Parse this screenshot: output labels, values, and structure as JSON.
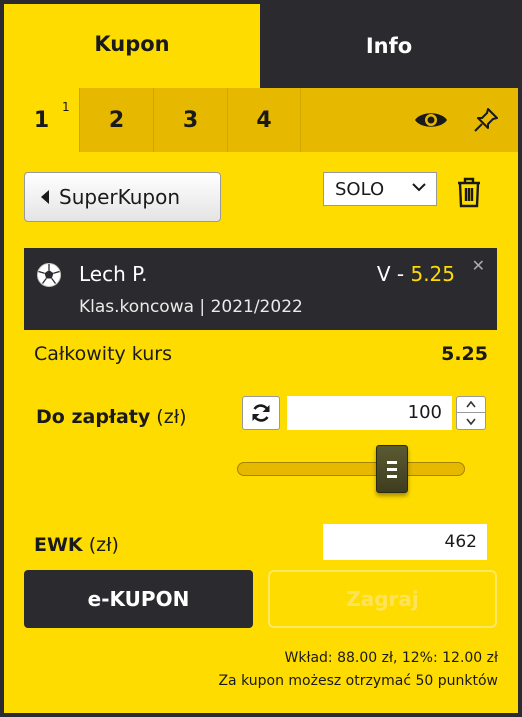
{
  "tabs": {
    "kupon": "Kupon",
    "info": "Info"
  },
  "numbers": [
    {
      "label": "1",
      "superscript": "1",
      "active": true
    },
    {
      "label": "2",
      "superscript": "",
      "active": false
    },
    {
      "label": "3",
      "superscript": "",
      "active": false
    },
    {
      "label": "4",
      "superscript": "",
      "active": false
    }
  ],
  "icons": {
    "visibility": "eye-icon",
    "pin": "pin-icon",
    "trash": "trash-icon",
    "refresh": "refresh-icon",
    "ball": "soccer-ball-icon"
  },
  "superkupon": {
    "label": "SuperKupon"
  },
  "mode_select": {
    "value": "SOLO"
  },
  "event": {
    "name": "Lech P.",
    "pick_prefix": "V - ",
    "odd": "5.25",
    "market": "Klas.koncowa | 2021/2022",
    "close": "✕"
  },
  "totals": {
    "odds_label": "Całkowity kurs",
    "odds_value": "5.25"
  },
  "stake": {
    "label_bold": "Do zapłaty",
    "label_unit": " (zł)",
    "amount": "100",
    "slider_fraction": 0.68
  },
  "ewk": {
    "label_bold": "EWK",
    "label_unit": " (zł)",
    "value": "462"
  },
  "buttons": {
    "ekupon": "e-KUPON",
    "zagraj": "Zagraj"
  },
  "footer": {
    "line1": "Wkład: 88.00 zł, 12%: 12.00 zł",
    "line2": "Za kupon możesz otrzymać 50 punktów"
  },
  "colors": {
    "accent": "#ffdc00",
    "dark": "#2b2a2e",
    "strip": "#e6b800"
  }
}
